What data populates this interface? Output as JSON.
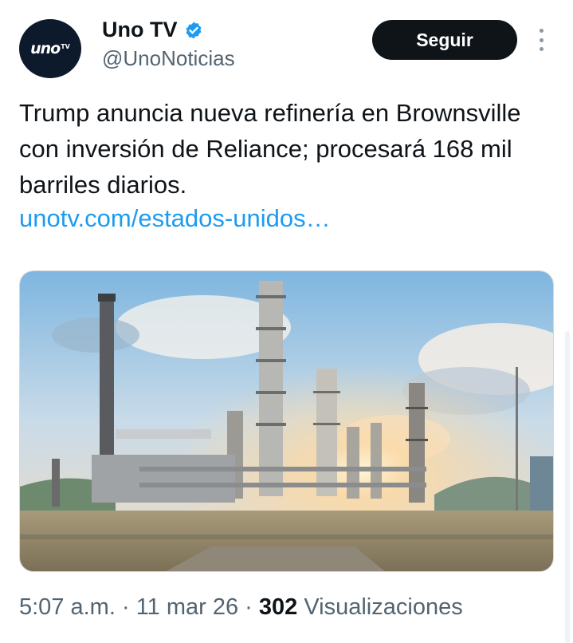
{
  "author": {
    "display_name": "Uno TV",
    "handle": "@UnoNoticias",
    "avatar_text": "uno",
    "avatar_suffix": "TV"
  },
  "actions": {
    "follow_label": "Seguir"
  },
  "tweet": {
    "text": "Trump anuncia nueva refinería en Brownsville con inversión de Reliance; procesará 168 mil barriles diarios.",
    "link": "unotv.com/estados-unidos…"
  },
  "meta": {
    "time": "5:07 a.m.",
    "date": "11 mar 26",
    "views_count": "302",
    "views_label": "Visualizaciones"
  },
  "colors": {
    "accent": "#1d9bf0",
    "verified": "#1d9bf0",
    "button": "#0f1419"
  },
  "icons": [
    "verified-badge-icon",
    "more-options-icon"
  ]
}
